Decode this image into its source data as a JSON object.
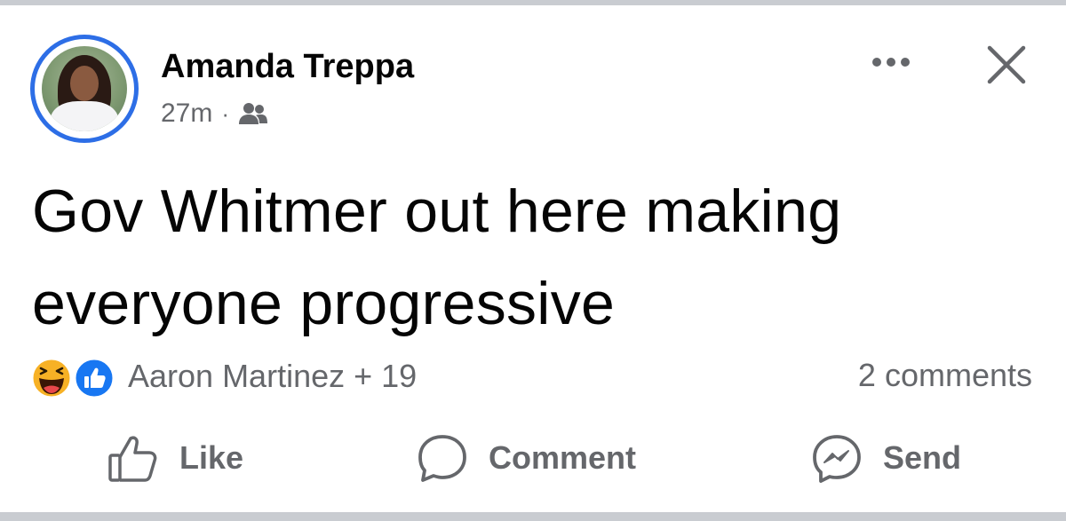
{
  "post": {
    "author": "Amanda Treppa",
    "time": "27m",
    "separator": "·",
    "audience_icon": "friends-icon",
    "text": "Gov Whitmer out here making everyone progressive"
  },
  "header_icons": {
    "more": "more-options-icon",
    "close": "close-icon"
  },
  "reactions": {
    "icons": [
      "haha-icon",
      "like-icon"
    ],
    "summary": "Aaron Martinez + 19",
    "comments": "2 comments"
  },
  "actions": {
    "like": "Like",
    "comment": "Comment",
    "send": "Send"
  },
  "colors": {
    "accent": "#1877f2",
    "ring": "#2d6ee6",
    "secondary_text": "#65676b",
    "divider": "#c9ccd1",
    "haha": "#f7b125"
  }
}
